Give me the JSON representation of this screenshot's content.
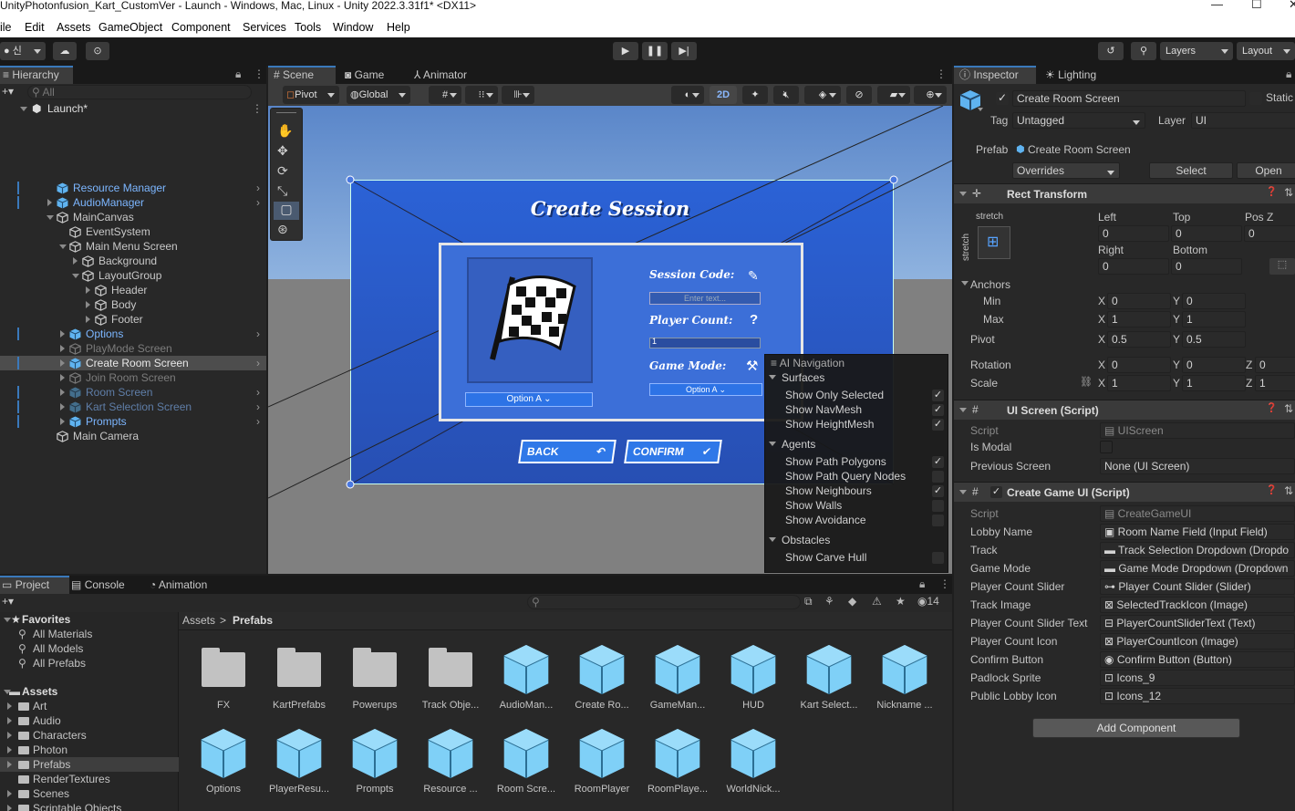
{
  "window": {
    "title": "UnityPhotonfusion_Kart_CustomVer - Launch - Windows, Mac, Linux - Unity 2022.3.31f1* <DX11>",
    "min": "—",
    "max": "☐",
    "close": "✕"
  },
  "menu": [
    "ile",
    "Edit",
    "Assets",
    "GameObject",
    "Component",
    "Services",
    "Tools",
    "Window",
    "Help"
  ],
  "toolbar": {
    "account": "신",
    "layers": "Layers",
    "layout": "Layout"
  },
  "hierarchy": {
    "tab": "Hierarchy",
    "search_placeholder": "All",
    "scene": "Launch*",
    "items": [
      {
        "label": "Resource Manager",
        "style": "blue",
        "indent": 1,
        "arrow": "none",
        "more": true
      },
      {
        "label": "AudioManager",
        "style": "blue",
        "indent": 1,
        "arrow": "right",
        "more": true
      },
      {
        "label": "MainCanvas",
        "style": "normal",
        "indent": 1,
        "arrow": "down",
        "more": false
      },
      {
        "label": "EventSystem",
        "style": "normal",
        "indent": 2,
        "arrow": "none",
        "more": false
      },
      {
        "label": "Main Menu Screen",
        "style": "normal",
        "indent": 2,
        "arrow": "down",
        "more": false
      },
      {
        "label": "Background",
        "style": "normal",
        "indent": 3,
        "arrow": "right",
        "more": false
      },
      {
        "label": "LayoutGroup",
        "style": "normal",
        "indent": 3,
        "arrow": "down",
        "more": false
      },
      {
        "label": "Header",
        "style": "normal",
        "indent": 4,
        "arrow": "right",
        "more": false
      },
      {
        "label": "Body",
        "style": "normal",
        "indent": 4,
        "arrow": "right",
        "more": false
      },
      {
        "label": "Footer",
        "style": "normal",
        "indent": 4,
        "arrow": "right",
        "more": false
      },
      {
        "label": "Options",
        "style": "blue",
        "indent": 2,
        "arrow": "right",
        "more": true
      },
      {
        "label": "PlayMode Screen",
        "style": "dim",
        "indent": 2,
        "arrow": "right",
        "more": false
      },
      {
        "label": "Create Room Screen",
        "style": "selected",
        "indent": 2,
        "arrow": "right",
        "more": true
      },
      {
        "label": "Join Room Screen",
        "style": "dim",
        "indent": 2,
        "arrow": "right",
        "more": false
      },
      {
        "label": "Room Screen",
        "style": "dimblue",
        "indent": 2,
        "arrow": "right",
        "more": true
      },
      {
        "label": "Kart Selection Screen",
        "style": "dimblue",
        "indent": 2,
        "arrow": "right",
        "more": true
      },
      {
        "label": "Prompts",
        "style": "blue",
        "indent": 2,
        "arrow": "right",
        "more": true
      },
      {
        "label": "Main Camera",
        "style": "normal",
        "indent": 1,
        "arrow": "none",
        "more": false
      }
    ]
  },
  "scene": {
    "tabs": [
      "Scene",
      "Game",
      "Animator"
    ],
    "pivot": "Pivot",
    "global": "Global",
    "mode2d": "2D",
    "ui": {
      "title": "Create Session",
      "session_code": "Session Code:",
      "enter_text": "Enter text...",
      "player_count": "Player Count:",
      "player_count_value": "1",
      "game_mode": "Game Mode:",
      "option_a": "Option A",
      "option_a2": "Option A",
      "back": "BACK",
      "confirm": "CONFIRM"
    },
    "ai_menu": {
      "title": "AI Navigation",
      "sections": [
        {
          "name": "Surfaces",
          "items": [
            {
              "label": "Show Only Selected",
              "checked": true
            },
            {
              "label": "Show NavMesh",
              "checked": true
            },
            {
              "label": "Show HeightMesh",
              "checked": true
            }
          ]
        },
        {
          "name": "Agents",
          "items": [
            {
              "label": "Show Path Polygons",
              "checked": true
            },
            {
              "label": "Show Path Query Nodes",
              "checked": false
            },
            {
              "label": "Show Neighbours",
              "checked": true
            },
            {
              "label": "Show Walls",
              "checked": false
            },
            {
              "label": "Show Avoidance",
              "checked": false
            }
          ]
        },
        {
          "name": "Obstacles",
          "items": [
            {
              "label": "Show Carve Hull",
              "checked": false
            }
          ]
        }
      ]
    }
  },
  "inspector": {
    "tabs": [
      "Inspector",
      "Lighting"
    ],
    "object_name": "Create Room Screen",
    "static": "Static",
    "tag_label": "Tag",
    "tag": "Untagged",
    "layer_label": "Layer",
    "layer": "UI",
    "prefab_label": "Prefab",
    "prefab": "Create Room Screen",
    "overrides": "Overrides",
    "select": "Select",
    "open": "Open",
    "rect": {
      "title": "Rect Transform",
      "stretch": "stretch",
      "stretch_v": "stretch",
      "left_l": "Left",
      "top_l": "Top",
      "posz_l": "Pos Z",
      "left": "0",
      "top": "0",
      "posz": "0",
      "right_l": "Right",
      "bottom_l": "Bottom",
      "right": "0",
      "bottom": "0",
      "anchors": "Anchors",
      "min": "Min",
      "max": "Max",
      "min_x": "0",
      "min_y": "0",
      "max_x": "1",
      "max_y": "1",
      "pivot": "Pivot",
      "pivot_x": "0.5",
      "pivot_y": "0.5",
      "rotation": "Rotation",
      "rot_x": "0",
      "rot_y": "0",
      "rot_z": "0",
      "scale": "Scale",
      "scale_x": "1",
      "scale_y": "1",
      "scale_z": "1",
      "x": "X",
      "y": "Y",
      "z": "Z"
    },
    "ui_screen": {
      "title": "UI Screen (Script)",
      "script_l": "Script",
      "script": "UIScreen",
      "modal_l": "Is Modal",
      "prev_l": "Previous Screen",
      "prev": "None (UI Screen)"
    },
    "create_game": {
      "title": "Create Game UI (Script)",
      "fields": [
        {
          "label": "Script",
          "value": "CreateGameUI",
          "dim": true
        },
        {
          "label": "Lobby Name",
          "value": "Room Name Field (Input Field)"
        },
        {
          "label": "Track",
          "value": "Track Selection Dropdown (Dropdo"
        },
        {
          "label": "Game Mode",
          "value": "Game Mode Dropdown (Dropdown"
        },
        {
          "label": "Player Count Slider",
          "value": "Player Count Slider (Slider)"
        },
        {
          "label": "Track Image",
          "value": "SelectedTrackIcon (Image)"
        },
        {
          "label": "Player Count Slider Text",
          "value": "PlayerCountSliderText (Text)"
        },
        {
          "label": "Player Count Icon",
          "value": "PlayerCountIcon (Image)"
        },
        {
          "label": "Confirm Button",
          "value": "Confirm Button (Button)"
        },
        {
          "label": "Padlock Sprite",
          "value": "Icons_9"
        },
        {
          "label": "Public Lobby Icon",
          "value": "Icons_12"
        }
      ]
    },
    "add_component": "Add Component"
  },
  "project": {
    "tabs": [
      "Project",
      "Console",
      "Animation"
    ],
    "count": "14",
    "breadcrumb_root": "Assets",
    "breadcrumb_sep": ">",
    "breadcrumb_leaf": "Prefabs",
    "favorites": "Favorites",
    "fav_items": [
      "All Materials",
      "All Models",
      "All Prefabs"
    ],
    "assets_root": "Assets",
    "folders": [
      "Art",
      "Audio",
      "Characters",
      "Photon",
      "Prefabs",
      "RenderTextures",
      "Scenes",
      "Scriptable Objects"
    ],
    "assets": [
      {
        "name": "FX",
        "kind": "folder"
      },
      {
        "name": "KartPrefabs",
        "kind": "folder"
      },
      {
        "name": "Powerups",
        "kind": "folder"
      },
      {
        "name": "Track Obje...",
        "kind": "folder"
      },
      {
        "name": "AudioMan...",
        "kind": "prefab"
      },
      {
        "name": "Create Ro...",
        "kind": "prefab"
      },
      {
        "name": "GameMan...",
        "kind": "prefab"
      },
      {
        "name": "HUD",
        "kind": "prefab"
      },
      {
        "name": "Kart Select...",
        "kind": "prefab"
      },
      {
        "name": "Nickname ...",
        "kind": "prefab"
      },
      {
        "name": "Options",
        "kind": "prefab"
      },
      {
        "name": "PlayerResu...",
        "kind": "prefab"
      },
      {
        "name": "Prompts",
        "kind": "prefab"
      },
      {
        "name": "Resource ...",
        "kind": "prefab"
      },
      {
        "name": "Room Scre...",
        "kind": "prefab"
      },
      {
        "name": "RoomPlayer",
        "kind": "prefab"
      },
      {
        "name": "RoomPlaye...",
        "kind": "prefab"
      },
      {
        "name": "WorldNick...",
        "kind": "prefab"
      }
    ]
  }
}
